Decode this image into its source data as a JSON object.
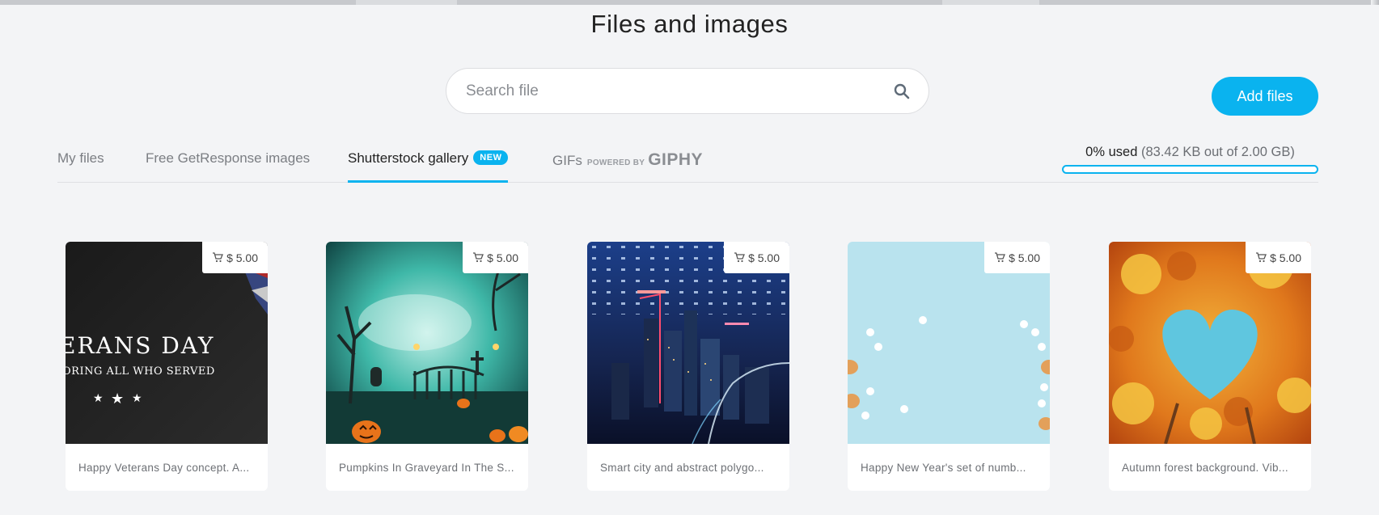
{
  "modal": {
    "title": "Files and images",
    "add_files_label": "Add files"
  },
  "search": {
    "placeholder": "Search file",
    "icon": "search-icon"
  },
  "tabs": [
    {
      "label": "My files",
      "active": false
    },
    {
      "label": "Free GetResponse images",
      "active": false
    },
    {
      "label": "Shutterstock gallery",
      "active": true,
      "badge": "NEW"
    },
    {
      "label": "GIFs",
      "active": false,
      "powered_by": "POWERED BY",
      "brand": "GIPHY"
    }
  ],
  "storage": {
    "percent_label": "0% used",
    "detail": "(83.42 KB out of 2.00 GB)",
    "used_fraction": 0.0
  },
  "colors": {
    "accent": "#0ab3ef",
    "background": "#f3f4f6"
  },
  "gallery": [
    {
      "price": "$ 5.00",
      "caption": "Happy Veterans Day concept. A...",
      "thumb_text_1": "ERANS DAY",
      "thumb_text_2": "ORING ALL WHO SERVED",
      "cart_icon": "cart-icon"
    },
    {
      "price": "$ 5.00",
      "caption": "Pumpkins In Graveyard In The S...",
      "cart_icon": "cart-icon"
    },
    {
      "price": "$ 5.00",
      "caption": "Smart city and abstract polygo...",
      "cart_icon": "cart-icon"
    },
    {
      "price": "$ 5.00",
      "caption": "Happy New Year's set of numb...",
      "cart_icon": "cart-icon"
    },
    {
      "price": "$ 5.00",
      "caption": "Autumn forest background. Vib...",
      "cart_icon": "cart-icon"
    }
  ]
}
